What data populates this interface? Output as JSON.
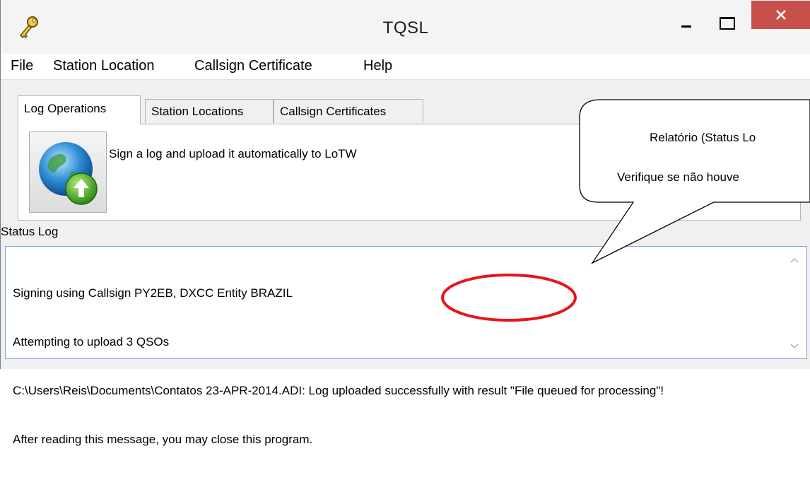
{
  "window": {
    "title": "TQSL",
    "icon": "key-icon",
    "controls": [
      "minimize-icon",
      "maximize-icon",
      "close-icon"
    ]
  },
  "menu": {
    "items": [
      "File",
      "Station Location",
      "Callsign Certificate",
      "Help"
    ]
  },
  "tabs": [
    "Log Operations",
    "Station Locations",
    "Callsign Certificates"
  ],
  "log_operations": {
    "upload_caption": "Sign a log and upload it automatically to LoTW",
    "upload_icon": "globe-upload-icon"
  },
  "status_log": {
    "label": "Status Log",
    "lines": [
      "Signing using Callsign PY2EB, DXCC Entity BRAZIL",
      "Attempting to upload 3 QSOs",
      "C:\\Users\\Reis\\Documents\\Contatos 23-APR-2014.ADI: Log uploaded successfully with result \"File queued for processing\"!",
      "After reading this message, you may close this program."
    ]
  },
  "annotation": {
    "line1": "Relatório (Status Lo",
    "line2": "Verifique se não houve",
    "highlight_color": "#e8141b"
  },
  "colors": {
    "close_button": "#c7504a",
    "status_border": "#7aa7d7"
  }
}
